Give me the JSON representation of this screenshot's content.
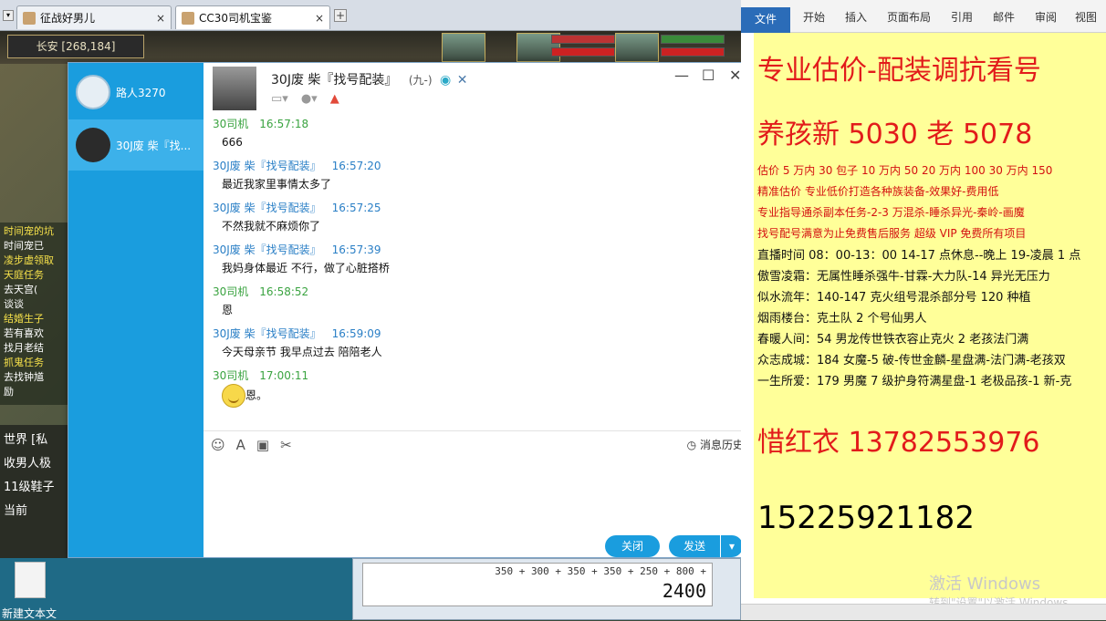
{
  "browser": {
    "tabs": [
      {
        "label": "征战好男儿",
        "active": false
      },
      {
        "label": "CC30司机宝鉴",
        "active": true
      }
    ]
  },
  "game": {
    "location": "长安 [268,184]",
    "left_panel_lines": [
      "时间宠的坑",
      "时间宠已",
      "凌步虚领取",
      "天庭任务",
      "去天宫(",
      "谈谈",
      "结婚生子",
      "若有喜欢",
      "找月老结",
      "抓鬼任务",
      "去找钟馗",
      "励"
    ],
    "chat_bottom_lines": [
      "世界 [私",
      "收男人极",
      "11级鞋子",
      "当前"
    ]
  },
  "qq": {
    "contacts": [
      {
        "name": "路人3270",
        "active": false
      },
      {
        "name": "30J废 柴『找...",
        "active": true
      }
    ],
    "chat_title": "30J废 柴『找号配装』",
    "chat_subtitle": "(九-)",
    "messages": [
      {
        "sender": "30司机",
        "time": "16:57:18",
        "text": "666",
        "mine": true
      },
      {
        "sender": "30J废 柴『找号配装』",
        "time": "16:57:20",
        "text": "最近我家里事情太多了",
        "mine": false
      },
      {
        "sender": "30J废 柴『找号配装』",
        "time": "16:57:25",
        "text": "不然我就不麻烦你了",
        "mine": false
      },
      {
        "sender": "30J废 柴『找号配装』",
        "time": "16:57:39",
        "text": "我妈身体最近 不行，做了心脏搭桥",
        "mine": false
      },
      {
        "sender": "30司机",
        "time": "16:58:52",
        "text": "恩",
        "mine": true
      },
      {
        "sender": "30J废 柴『找号配装』",
        "time": "16:59:09",
        "text": "今天母亲节 我早点过去 陪陪老人",
        "mine": false
      },
      {
        "sender": "30司机",
        "time": "17:00:11",
        "text": "恩。",
        "mine": true
      }
    ],
    "history_label": "消息历史",
    "close_label": "关闭",
    "send_label": "发送"
  },
  "desktop": {
    "file_label": "新建文本文",
    "calc_expression": "350 + 300 + 350 + 350 + 250 + 800 +",
    "calc_result": "2400"
  },
  "word": {
    "ribbon_tabs": [
      "文件",
      "开始",
      "插入",
      "页面布局",
      "引用",
      "邮件",
      "审阅",
      "视图"
    ],
    "lines": [
      {
        "text": "专业估价-配装调抗看号",
        "style": "big"
      },
      {
        "text": "养孩新 5030 老 5078",
        "style": "big"
      },
      {
        "text": "估价 5 万内 30 包子  10 万内 50  20 万内 100  30 万内 150",
        "style": "red"
      },
      {
        "text": "精准估价  专业低价打造各种族装备-效果好-费用低",
        "style": "red"
      },
      {
        "text": "专业指导通杀副本任务-2-3 万混杀-睡杀异光-秦岭-画魔",
        "style": "red"
      },
      {
        "text": "找号配号满意为止免费售后服务   超级 VIP 免费所有项目",
        "style": "red"
      },
      {
        "text": "直播时间 08：00-13：00  14-17 点休息--晚上 19-凌晨 1 点",
        "style": "blk"
      },
      {
        "text": "傲雪凌霜：无属性睡杀强牛-甘霖-大力队-14 异光无压力",
        "style": "blk"
      },
      {
        "text": "似水流年：140-147 克火组号混杀部分号 120 种植",
        "style": "blk"
      },
      {
        "text": "烟雨楼台：克土队 2 个号仙男人",
        "style": "blk"
      },
      {
        "text": "春暖人间：54 男龙传世铁衣容止克火 2 老孩法门满",
        "style": "blk"
      },
      {
        "text": "众志成城：184 女魔-5 破-传世金麟-星盘满-法门满-老孩双",
        "style": "blk"
      },
      {
        "text": "一生所爱：179 男魔 7 级护身符满星盘-1 老极品孩-1 新-克",
        "style": "blk"
      },
      {
        "text": "惜红衣 13782553976",
        "style": "big"
      },
      {
        "text": "15225921182",
        "style": "phone"
      }
    ],
    "watermark_title": "激活 Windows",
    "watermark_sub": "转到\"设置\"以激活 Windows。"
  },
  "colors": {
    "qq_blue": "#1a9dde",
    "doc_highlight": "#ffff99",
    "doc_red": "#e21b1b"
  }
}
